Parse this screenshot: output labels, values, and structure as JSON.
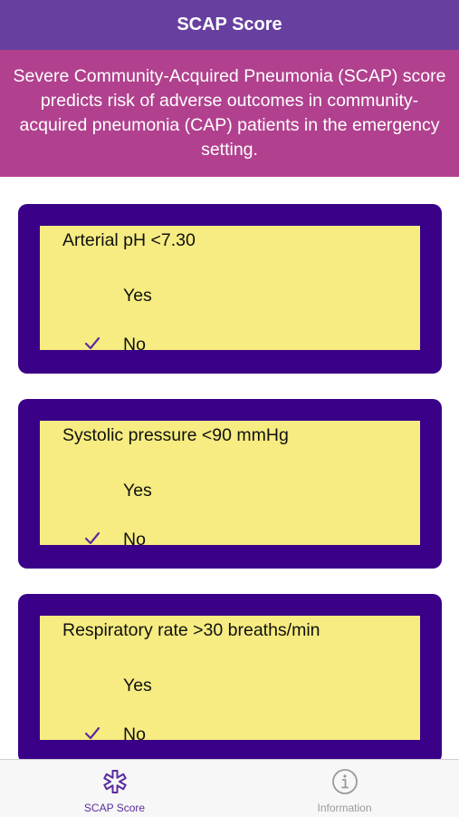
{
  "header": {
    "title": "SCAP Score"
  },
  "banner": {
    "text": "Severe Community-Acquired Pneumonia (SCAP) score predicts risk of adverse outcomes in community-acquired pneumonia (CAP) patients in the emergency setting."
  },
  "questions": [
    {
      "label": "Arterial pH <7.30",
      "options": [
        {
          "label": "Yes",
          "selected": false
        },
        {
          "label": "No",
          "selected": true
        }
      ]
    },
    {
      "label": "Systolic pressure <90 mmHg",
      "options": [
        {
          "label": "Yes",
          "selected": false
        },
        {
          "label": "No",
          "selected": true
        }
      ]
    },
    {
      "label": "Respiratory rate >30 breaths/min",
      "options": [
        {
          "label": "Yes",
          "selected": false
        },
        {
          "label": "No",
          "selected": true
        }
      ]
    }
  ],
  "tabs": [
    {
      "label": "SCAP Score",
      "icon": "asterisk-icon",
      "active": true
    },
    {
      "label": "Information",
      "icon": "info-icon",
      "active": false
    }
  ],
  "colors": {
    "navbar": "#67409f",
    "banner": "#b1418e",
    "card_border": "#3a0088",
    "card_fill": "#f6ec81",
    "check": "#5a2ca0",
    "tab_active": "#5a2ca0",
    "tab_inactive": "#9a9a9a"
  }
}
